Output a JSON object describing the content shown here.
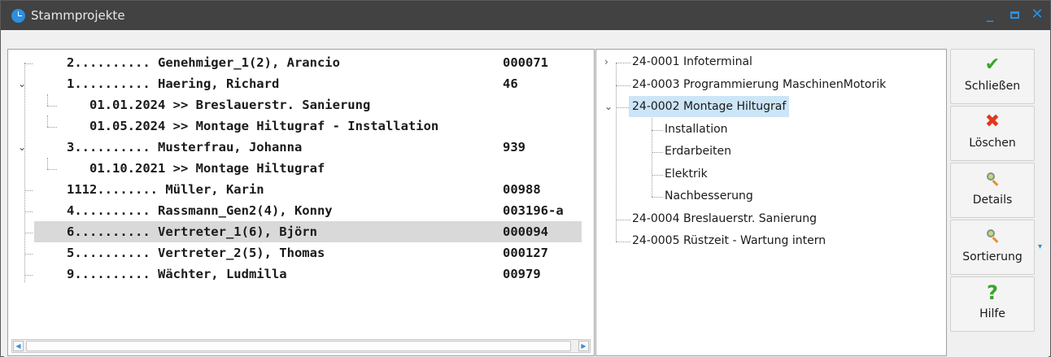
{
  "window": {
    "title": "Stammprojekte",
    "controls": {
      "minimize": "_",
      "maximize": "□",
      "close": "✕"
    },
    "accent_color": "#2c8fe0",
    "titlebar_color": "#424242"
  },
  "left_tree": {
    "rows": [
      {
        "text": "2.......... Genehmiger_1(2), Arancio",
        "number": "000071",
        "level": 0,
        "expander": ""
      },
      {
        "text": "1.......... Haering, Richard",
        "number": "46",
        "level": 0,
        "expander": "expanded"
      },
      {
        "text": "01.01.2024 >> Breslauerstr. Sanierung",
        "number": "",
        "level": 1,
        "expander": ""
      },
      {
        "text": "01.05.2024 >> Montage Hiltugraf - Installation",
        "number": "",
        "level": 1,
        "expander": ""
      },
      {
        "text": "3.......... Musterfrau, Johanna",
        "number": "939",
        "level": 0,
        "expander": "expanded"
      },
      {
        "text": "01.10.2021 >> Montage Hiltugraf",
        "number": "",
        "level": 1,
        "expander": ""
      },
      {
        "text": "1112........ Müller, Karin",
        "number": "00988",
        "level": 0,
        "expander": ""
      },
      {
        "text": "4.......... Rassmann_Gen2(4), Konny",
        "number": "003196-a",
        "level": 0,
        "expander": ""
      },
      {
        "text": "6.......... Vertreter_1(6), Björn",
        "number": "000094",
        "level": 0,
        "expander": "",
        "selected": true
      },
      {
        "text": "5.......... Vertreter_2(5), Thomas",
        "number": "000127",
        "level": 0,
        "expander": ""
      },
      {
        "text": "9.......... Wächter, Ludmilla",
        "number": "00979",
        "level": 0,
        "expander": ""
      }
    ],
    "expander_icon": "chevron-down-icon",
    "selected_color": "#d9d9d9"
  },
  "right_tree": {
    "rows": [
      {
        "text": "24-0001 Infoterminal",
        "level": 0,
        "expander": "collapsed"
      },
      {
        "text": "24-0003 Programmierung MaschinenMotorik",
        "level": 0,
        "expander": ""
      },
      {
        "text": "24-0002 Montage Hiltugraf",
        "level": 0,
        "expander": "expanded",
        "selected": true
      },
      {
        "text": "Installation",
        "level": 1,
        "expander": ""
      },
      {
        "text": "Erdarbeiten",
        "level": 1,
        "expander": ""
      },
      {
        "text": "Elektrik",
        "level": 1,
        "expander": ""
      },
      {
        "text": "Nachbesserung",
        "level": 1,
        "expander": ""
      },
      {
        "text": "24-0004 Breslauerstr. Sanierung",
        "level": 0,
        "expander": ""
      },
      {
        "text": "24-0005 Rüstzeit - Wartung intern",
        "level": 0,
        "expander": ""
      }
    ],
    "selected_color": "#cce5f7"
  },
  "buttons": [
    {
      "label": "Schließen",
      "icon": "check-icon",
      "color": "#3aa52e"
    },
    {
      "label": "Löschen",
      "icon": "delete-x-icon",
      "color": "#e0391f"
    },
    {
      "label": "Details",
      "icon": "magnifier-icon",
      "color": "#8c8c8c"
    },
    {
      "label": "Sortierung",
      "icon": "magnifier-icon",
      "color": "#8c8c8c"
    },
    {
      "label": "Hilfe",
      "icon": "help-question-icon",
      "color": "#3aa52e"
    }
  ],
  "glyphs": {
    "check": "✔",
    "cross": "✖",
    "question": "?",
    "chev_down": "⌄",
    "chev_right": "›",
    "scroll_left": "◀",
    "scroll_right": "▶",
    "dropdown": "▾"
  }
}
